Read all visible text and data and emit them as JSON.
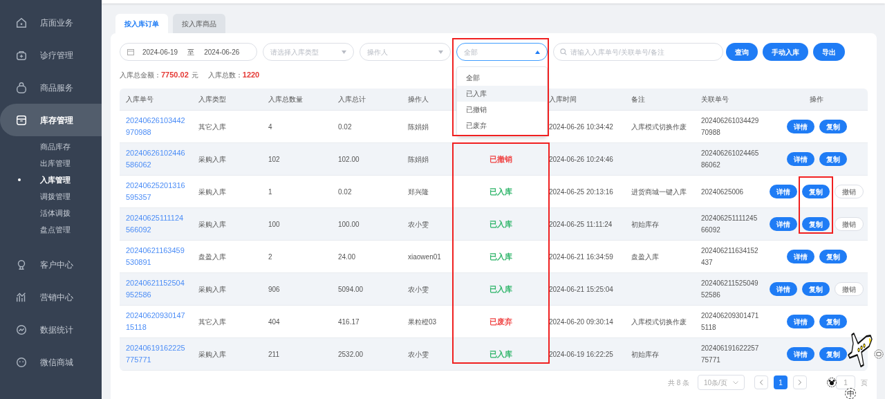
{
  "sidebar": {
    "items": [
      {
        "label": "店面业务",
        "selected": false
      },
      {
        "label": "诊疗管理",
        "selected": false
      },
      {
        "label": "商品服务",
        "selected": false
      },
      {
        "label": "库存管理",
        "selected": true,
        "children": [
          {
            "label": "商品库存",
            "selected": false
          },
          {
            "label": "出库管理",
            "selected": false
          },
          {
            "label": "入库管理",
            "selected": true
          },
          {
            "label": "调拨管理",
            "selected": false
          },
          {
            "label": "活体调拨",
            "selected": false
          },
          {
            "label": "盘点管理",
            "selected": false
          }
        ]
      },
      {
        "label": "客户中心",
        "selected": false
      },
      {
        "label": "营销中心",
        "selected": false
      },
      {
        "label": "数据统计",
        "selected": false
      },
      {
        "label": "微信商城",
        "selected": false
      }
    ]
  },
  "tabs": [
    {
      "label": "按入库订单",
      "selected": true
    },
    {
      "label": "按入库商品",
      "selected": false
    }
  ],
  "filters": {
    "date_start": "2024-06-19",
    "date_separator": "至",
    "date_end": "2024-06-26",
    "type_select": {
      "placeholder": "请选择入库类型"
    },
    "operator_select": {
      "placeholder": "操作人"
    },
    "status_select": {
      "placeholder": "全部",
      "expanded": true,
      "options": [
        {
          "label": "全部",
          "hovered": false
        },
        {
          "label": "已入库",
          "hovered": true
        },
        {
          "label": "已撤销",
          "hovered": false
        },
        {
          "label": "已废弃",
          "hovered": false
        }
      ]
    },
    "search": {
      "placeholder": "请输入入库单号/关联单号/备注"
    },
    "buttons": [
      "查询",
      "手动入库",
      "导出"
    ]
  },
  "summary": [
    {
      "label": "入库总金额：",
      "value": "7750.02",
      "unit": "元"
    },
    {
      "label": "入库总数：",
      "value": "1220"
    }
  ],
  "table": {
    "columns": [
      {
        "label": "入库单号"
      },
      {
        "label": "入库类型"
      },
      {
        "label": "入库总数量"
      },
      {
        "label": "入库总计"
      },
      {
        "label": "操作人"
      },
      {
        "label": "入库时间"
      },
      {
        "label": "备注"
      },
      {
        "label": "关联单号"
      },
      {
        "label": "操作"
      }
    ],
    "rows": [
      {
        "id": "20240626103442970988",
        "type": "其它入库",
        "qty": "4",
        "total": "0.02",
        "operator": "陈娟娟",
        "time": "2024-06-26 10:34:42",
        "note": "入库模式切换作废",
        "related": "20240626103442970988",
        "actions": [
          "详情",
          "复制"
        ]
      },
      {
        "id": "20240626102446586062",
        "type": "采购入库",
        "qty": "102",
        "total": "102.00",
        "operator": "陈娟娟",
        "status": "已撤销",
        "color": "#f04848",
        "time": "2024-06-26 10:24:46",
        "related": "20240626102446586062",
        "actions": [
          "详情",
          "复制"
        ]
      },
      {
        "id": "20240625201316595357",
        "type": "采购入库",
        "qty": "1",
        "total": "0.02",
        "operator": "郑兴隆",
        "status": "已入库",
        "color": "#2fb56a",
        "time": "2024-06-25 20:13:16",
        "note": "进货商城一键入库",
        "related": "20240625006",
        "actions": [
          "详情",
          "复制",
          "撤销"
        ]
      },
      {
        "id": "20240625111124566092",
        "type": "采购入库",
        "qty": "100",
        "total": "100.00",
        "operator": "农小雯",
        "status": "已入库",
        "color": "#2fb56a",
        "time": "2024-06-25 11:11:24",
        "note": "初始库存",
        "related": "20240625111124566092",
        "actions": [
          "详情",
          "复制",
          "撤销"
        ]
      },
      {
        "id": "20240621163459530891",
        "type": "盘盈入库",
        "qty": "2",
        "total": "24.00",
        "operator": "xiaowen01",
        "status": "已入库",
        "color": "#2fb56a",
        "time": "2024-06-21 16:34:59",
        "note": "盘盈入库",
        "related": "202406211634152437",
        "actions": [
          "详情",
          "复制"
        ]
      },
      {
        "id": "20240621152504952586",
        "type": "采购入库",
        "qty": "906",
        "total": "5094.00",
        "operator": "农小雯",
        "status": "已入库",
        "color": "#2fb56a",
        "time": "2024-06-21 15:25:04",
        "related": "20240621152504952586",
        "actions": [
          "详情",
          "复制",
          "撤销"
        ]
      },
      {
        "id": "2024062093014715118",
        "type": "其它入库",
        "qty": "404",
        "total": "416.17",
        "operator": "果粒橙03",
        "status": "已废弃",
        "color": "#f04848",
        "time": "2024-06-20 09:30:14",
        "note": "入库模式切换作废",
        "related": "2024062093014715118",
        "actions": [
          "详情",
          "复制"
        ]
      },
      {
        "id": "20240619162225775771",
        "type": "采购入库",
        "qty": "211",
        "total": "2532.00",
        "operator": "农小雯",
        "status": "已入库",
        "color": "#2fb56a",
        "time": "2024-06-19 16:22:25",
        "note": "初始库存",
        "related": "20240619162225775771",
        "actions": [
          "详情",
          "复制"
        ]
      }
    ]
  },
  "pagination": {
    "total": "共 8 条",
    "page_size": "10条/页",
    "pages": [
      {
        "label": "1",
        "selected": true
      }
    ],
    "jump_value": "1",
    "jump_suffix": "页"
  },
  "mascot": {
    "badge": "中"
  },
  "annotations": [
    {
      "kind": "status-filter"
    },
    {
      "kind": "status-column"
    },
    {
      "kind": "copy-buttons"
    }
  ]
}
